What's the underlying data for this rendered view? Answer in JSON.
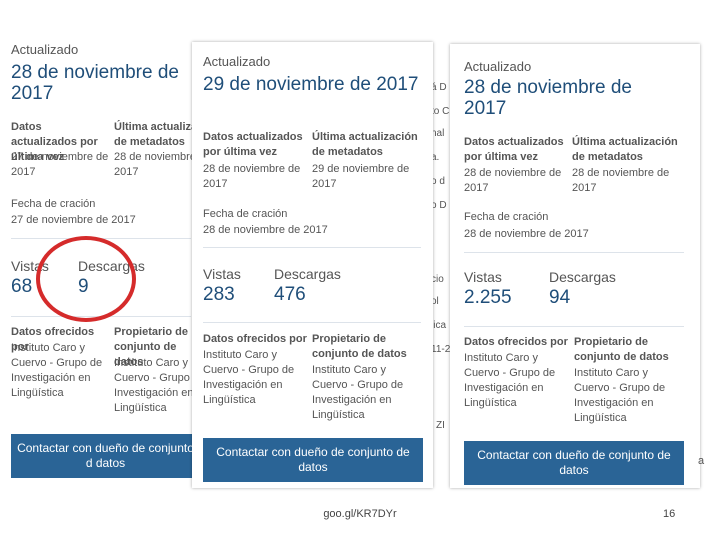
{
  "panel_left": {
    "updated_label": "Actualizado",
    "updated_date": "28 de noviembre de 2017",
    "data_updated_label": "Datos actualizados por última vez",
    "data_updated_value": "27 de noviembre de 2017",
    "meta_updated_label": "Última actualizac de metadatos",
    "meta_updated_value": "28 de noviembre 2017",
    "created_label": "Fecha de cración",
    "created_value": "27 de noviembre de 2017",
    "views_label": "Vistas",
    "views_value": "68",
    "downloads_label": "Descargas",
    "downloads_value": "9",
    "offered_label": "Datos ofrecidos por",
    "offered_value": "Instituto Caro y Cuervo - Grupo de Investigación en Lingüística",
    "owner_label": "Propietario de conjunto de datos",
    "owner_value": "Instituto Caro y Cuervo - Grupo d Investigación en Lingüística",
    "contact_button": "Contactar con dueño de conjunto d datos"
  },
  "panel_middle": {
    "updated_label": "Actualizado",
    "updated_date": "29 de noviembre de 2017",
    "data_updated_label": "Datos actualizados por última vez",
    "data_updated_value": "28 de noviembre de 2017",
    "meta_updated_label": "Última actualización de metadatos",
    "meta_updated_value": "29 de noviembre de 2017",
    "created_label": "Fecha de cración",
    "created_value": "28 de noviembre de 2017",
    "views_label": "Vistas",
    "views_value": "283",
    "downloads_label": "Descargas",
    "downloads_value": "476",
    "offered_label": "Datos ofrecidos por",
    "offered_value": "Instituto Caro y Cuervo - Grupo de Investigación en Lingüística",
    "owner_label": "Propietario de conjunto de datos",
    "owner_value": "Instituto Caro y Cuervo - Grupo de Investigación en Lingüística",
    "contact_button": "Contactar con dueño de conjunto de datos"
  },
  "panel_right": {
    "updated_label": "Actualizado",
    "updated_date": "28 de noviembre de 2017",
    "data_updated_label": "Datos actualizados por última vez",
    "data_updated_value": "28 de noviembre de 2017",
    "meta_updated_label": "Última actualización de metadatos",
    "meta_updated_value": "28 de noviembre de 2017",
    "created_label": "Fecha de cración",
    "created_value": "28 de noviembre de 2017",
    "views_label": "Vistas",
    "views_value": "2.255",
    "downloads_label": "Descargas",
    "downloads_value": "94",
    "offered_label": "Datos ofrecidos por",
    "offered_value": "Instituto Caro y Cuervo - Grupo de Investigación en Lingüística",
    "owner_label": "Propietario de conjunto de datos",
    "owner_value": "Instituto Caro y Cuervo - Grupo de Investigación en Lingüística",
    "contact_button": "Contactar con dueño de conjunto de datos"
  },
  "strip_fragments": [
    "á D",
    "to C",
    "nal",
    "a.",
    "o d",
    "o D",
    "cio",
    "ol",
    "lica",
    "11-2",
    "l ZI"
  ],
  "footer": {
    "url": "goo.gl/KR7DYr",
    "page_number": "16"
  },
  "colors": {
    "accent_text": "#1f4e79",
    "button_bg": "#2a6496",
    "highlight_circle": "#d52b2b"
  }
}
